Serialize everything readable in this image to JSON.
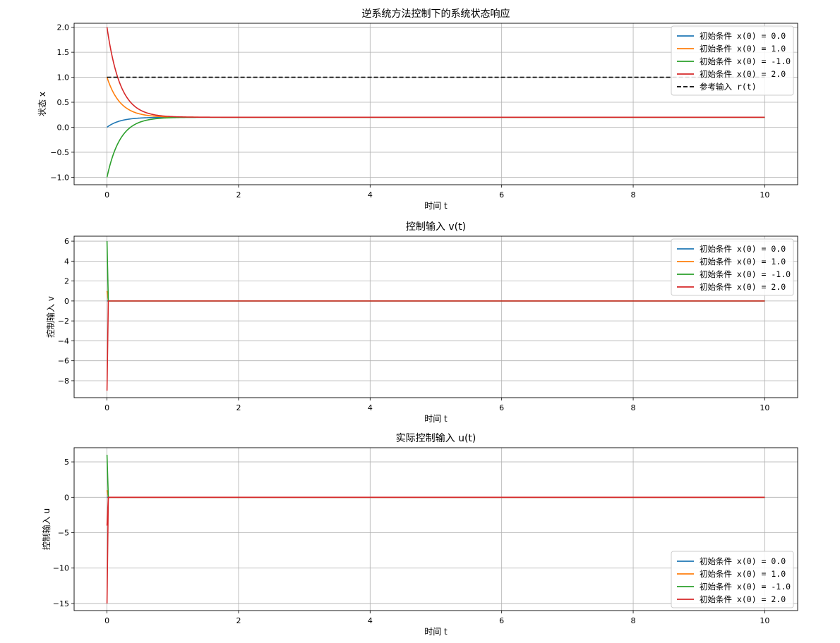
{
  "chart_data": [
    {
      "type": "line",
      "title": "逆系统方法控制下的系统状态响应",
      "xlabel": "时间 t",
      "ylabel": "状态 x",
      "xlim": [
        -0.5,
        10.5
      ],
      "ylim": [
        -1.15,
        2.08
      ],
      "xticks": [
        0,
        2,
        4,
        6,
        8,
        10
      ],
      "yticks": [
        -1.0,
        -0.5,
        0.0,
        0.5,
        1.0,
        1.5,
        2.0
      ],
      "ytick_labels": [
        "−1.0",
        "−0.5",
        "0.0",
        "0.5",
        "1.0",
        "1.5",
        "2.0"
      ],
      "grid": true,
      "legend": "top-right",
      "steady_state": 0.2,
      "series": [
        {
          "name": "初始条件 x(0) = 0.0",
          "color": "#1f77b4",
          "x0": 0.0
        },
        {
          "name": "初始条件 x(0) = 1.0",
          "color": "#ff7f0e",
          "x0": 1.0
        },
        {
          "name": "初始条件 x(0) = -1.0",
          "color": "#2ca02c",
          "x0": -1.0
        },
        {
          "name": "初始条件 x(0) = 2.0",
          "color": "#d62728",
          "x0": 2.0
        },
        {
          "name": "参考输入 r(t)",
          "color": "#000000",
          "dashed": true,
          "value": 1.0
        }
      ]
    },
    {
      "type": "line",
      "title": "控制输入 v(t)",
      "xlabel": "时间 t",
      "ylabel": "控制输入 v",
      "xlim": [
        -0.5,
        10.5
      ],
      "ylim": [
        -9.7,
        6.5
      ],
      "xticks": [
        0,
        2,
        4,
        6,
        8,
        10
      ],
      "yticks": [
        -8,
        -6,
        -4,
        -2,
        0,
        2,
        4,
        6
      ],
      "ytick_labels": [
        "−8",
        "−6",
        "−4",
        "−2",
        "0",
        "2",
        "4",
        "6"
      ],
      "grid": true,
      "legend": "top-right",
      "series": [
        {
          "name": "初始条件 x(0) = 0.0",
          "color": "#1f77b4",
          "v0": 0.0
        },
        {
          "name": "初始条件 x(0) = 1.0",
          "color": "#ff7f0e",
          "v0": 1.0
        },
        {
          "name": "初始条件 x(0) = -1.0",
          "color": "#2ca02c",
          "v0": 6.0
        },
        {
          "name": "初始条件 x(0) = 2.0",
          "color": "#d62728",
          "v0": -9.0
        }
      ]
    },
    {
      "type": "line",
      "title": "实际控制输入 u(t)",
      "xlabel": "时间 t",
      "ylabel": "控制输入 u",
      "xlim": [
        -0.5,
        10.5
      ],
      "ylim": [
        -16.0,
        7.0
      ],
      "xticks": [
        0,
        2,
        4,
        6,
        8,
        10
      ],
      "yticks": [
        -15,
        -10,
        -5,
        0,
        5
      ],
      "ytick_labels": [
        "−15",
        "−10",
        "−5",
        "0",
        "5"
      ],
      "grid": true,
      "legend": "lower-right",
      "series": [
        {
          "name": "初始条件 x(0) = 0.0",
          "color": "#1f77b4",
          "u0": 0.0
        },
        {
          "name": "初始条件 x(0) = 1.0",
          "color": "#ff7f0e",
          "u0": 1.0
        },
        {
          "name": "初始条件 x(0) = -1.0",
          "color": "#2ca02c",
          "u0": 6.0
        },
        {
          "name": "初始条件 x(0) = 2.0",
          "color": "#d62728",
          "u0": -15.0
        },
        {
          "name": "",
          "color": "#d62728",
          "u0": -4.0,
          "hidden_legend": true
        }
      ]
    }
  ]
}
